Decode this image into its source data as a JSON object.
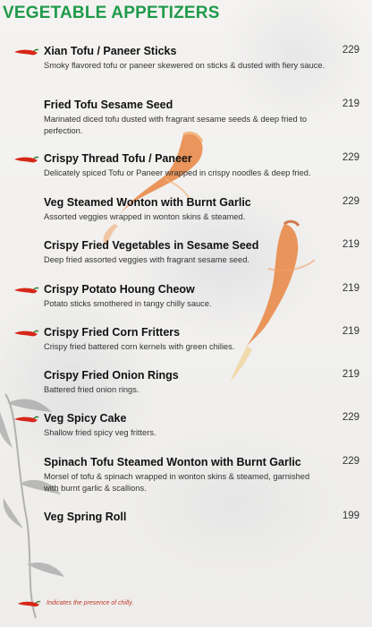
{
  "title": "VEGETABLE APPETIZERS",
  "items": [
    {
      "name": "Xian Tofu / Paneer Sticks",
      "desc": "Smoky flavored tofu or paneer skewered on sticks & dusted with fiery sauce.",
      "price": "229",
      "spicy": true
    },
    {
      "name": "Fried Tofu Sesame Seed",
      "desc": "Marinated diced tofu dusted with fragrant sesame seeds & deep fried to perfection.",
      "price": "219",
      "spicy": false
    },
    {
      "name": "Crispy Thread Tofu / Paneer",
      "desc": "Delicately spiced Tofu or Paneer wrapped in crispy noodles & deep fried.",
      "price": "229",
      "spicy": true
    },
    {
      "name": "Veg Steamed Wonton with Burnt Garlic",
      "desc": "Assorted veggies wrapped in wonton skins & steamed.",
      "price": "229",
      "spicy": false
    },
    {
      "name": "Crispy Fried Vegetables in Sesame Seed",
      "desc": "Deep fried assorted veggies with fragrant sesame seed.",
      "price": "219",
      "spicy": false
    },
    {
      "name": "Crispy Potato Houng Cheow",
      "desc": "Potato sticks smothered in tangy chilly sauce.",
      "price": "219",
      "spicy": true
    },
    {
      "name": "Crispy Fried Corn Fritters",
      "desc": "Crispy fried battered corn kernels with green chilies.",
      "price": "219",
      "spicy": true
    },
    {
      "name": "Crispy Fried Onion Rings",
      "desc": "Battered fried onion rings.",
      "price": "219",
      "spicy": false
    },
    {
      "name": "Veg Spicy Cake",
      "desc": "Shallow fried spicy veg fritters.",
      "price": "229",
      "spicy": true
    },
    {
      "name": "Spinach Tofu Steamed Wonton with Burnt Garlic",
      "desc": "Morsel of tofu & spinach wrapped in wonton skins & steamed, garnished with burnt garlic & scallions.",
      "price": "229",
      "spicy": false
    },
    {
      "name": "Veg Spring Roll",
      "desc": "",
      "price": "199",
      "spicy": false
    }
  ],
  "footnote": "Indicates the presence of chilly.",
  "colors": {
    "title": "#1f9a4a",
    "chilli": "#d62718"
  },
  "icons": {
    "chilli": "chilli-pepper-icon"
  }
}
